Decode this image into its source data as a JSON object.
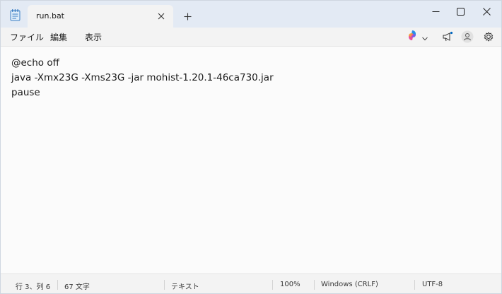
{
  "titlebar": {
    "tab_title": "run.bat",
    "icons": [
      "notepad-icon",
      "close-icon",
      "plus-icon",
      "minimize-icon",
      "maximize-icon",
      "close-window-icon"
    ]
  },
  "menu": {
    "file": "ファイル",
    "edit": "編集",
    "view": "表示"
  },
  "toolbar_icons": [
    "copilot-icon",
    "chevron-down-icon",
    "megaphone-icon",
    "avatar-icon",
    "gear-icon"
  ],
  "editor": {
    "lines": [
      "@echo off",
      "java -Xmx23G -Xms23G -jar mohist-1.20.1-46ca730.jar",
      "pause"
    ]
  },
  "status": {
    "position": "行 3、列 6",
    "chars": "67 文字",
    "format": "テキスト",
    "zoom": "100%",
    "line_ending": "Windows (CRLF)",
    "encoding": "UTF-8"
  },
  "colors": {
    "titlebar_bg": "#e3eaf4",
    "accent": "#0067c0"
  }
}
